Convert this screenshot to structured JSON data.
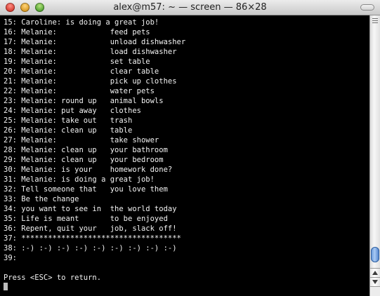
{
  "window": {
    "title": "alex@m57: ~ — screen — 86×28"
  },
  "terminal": {
    "lines": [
      "15: Caroline: is doing a great job!",
      "16: Melanie:            feed pets",
      "17: Melanie:            unload dishwasher",
      "18: Melanie:            load dishwasher",
      "19: Melanie:            set table",
      "20: Melanie:            clear table",
      "21: Melanie:            pick up clothes",
      "22: Melanie:            water pets",
      "23: Melanie: round up   animal bowls",
      "24: Melanie: put away   clothes",
      "25: Melanie: take out   trash",
      "26: Melanie: clean up   table",
      "27: Melanie:            take shower",
      "28: Melanie: clean up   your bathroom",
      "29: Melanie: clean up   your bedroom",
      "30: Melanie: is your    homework done?",
      "31: Melanie: is doing a great job!",
      "32: Tell someone that   you love them",
      "33: Be the change",
      "34: you want to see in  the world today",
      "35: Life is meant       to be enjoyed",
      "36: Repent, quit your   job, slack off!",
      "37: ************************************",
      "38: :-) :-) :-) :-) :-) :-) :-) :-) :-)",
      "39:",
      "",
      "Press <ESC> to return."
    ]
  },
  "icons": {
    "close": "close-button-icon",
    "minimize": "minimize-button-icon",
    "zoom": "zoom-button-icon",
    "scroll_up": "arrow-up-icon",
    "scroll_down": "arrow-down-icon"
  },
  "colors": {
    "terminal_bg": "#000000",
    "terminal_fg": "#f2f2f2",
    "scroll_thumb": "#5d8fd6"
  }
}
